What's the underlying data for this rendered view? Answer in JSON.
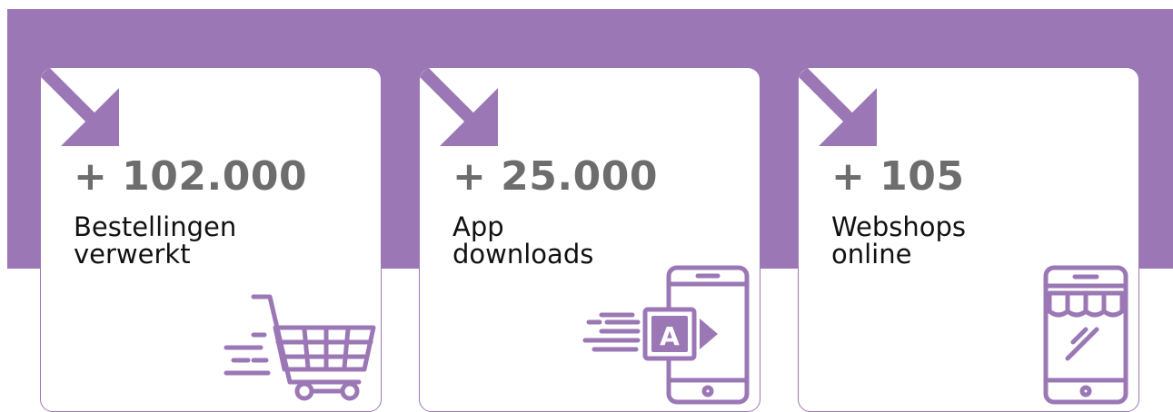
{
  "colors": {
    "accent": "#9b78b5",
    "number": "#6d6d6d",
    "label": "#111111"
  },
  "stats": [
    {
      "value": "+ 102.000",
      "label_line1": "Bestellingen",
      "label_line2": "verwerkt",
      "icon": "shopping-cart-icon"
    },
    {
      "value": "+ 25.000",
      "label_line1": "App",
      "label_line2": "downloads",
      "icon": "app-download-icon"
    },
    {
      "value": "+ 105",
      "label_line1": "Webshops",
      "label_line2": "online",
      "icon": "mobile-webshop-icon"
    }
  ]
}
